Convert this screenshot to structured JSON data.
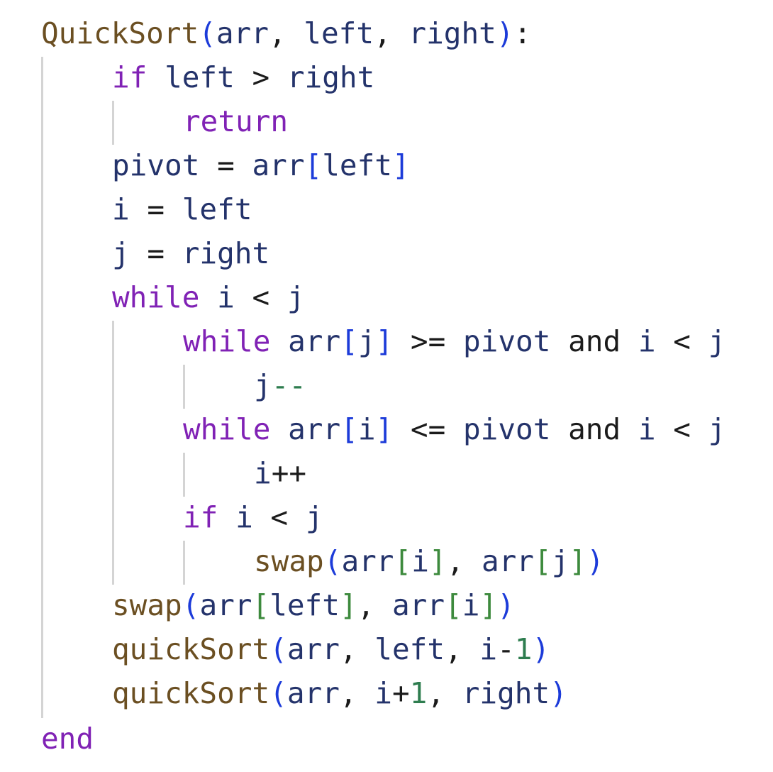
{
  "code_lines": [
    {
      "tokens": [
        [
          "fn",
          "QuickSort"
        ],
        [
          "bk1",
          "("
        ],
        [
          "var",
          "arr"
        ],
        [
          "op",
          ", "
        ],
        [
          "var",
          "left"
        ],
        [
          "op",
          ", "
        ],
        [
          "var",
          "right"
        ],
        [
          "bk1",
          ")"
        ],
        [
          "op",
          ":"
        ]
      ]
    },
    {
      "tokens": [
        [
          "kw",
          "if"
        ],
        [
          "op",
          " "
        ],
        [
          "var",
          "left"
        ],
        [
          "op",
          " > "
        ],
        [
          "var",
          "right"
        ]
      ]
    },
    {
      "tokens": [
        [
          "kw",
          "return"
        ]
      ]
    },
    {
      "tokens": [
        [
          "var",
          "pivot"
        ],
        [
          "op",
          " = "
        ],
        [
          "var",
          "arr"
        ],
        [
          "bk1",
          "["
        ],
        [
          "var",
          "left"
        ],
        [
          "bk1",
          "]"
        ]
      ]
    },
    {
      "tokens": [
        [
          "var",
          "i"
        ],
        [
          "op",
          " = "
        ],
        [
          "var",
          "left"
        ]
      ]
    },
    {
      "tokens": [
        [
          "var",
          "j"
        ],
        [
          "op",
          " = "
        ],
        [
          "var",
          "right"
        ]
      ]
    },
    {
      "tokens": [
        [
          "kw",
          "while"
        ],
        [
          "op",
          " "
        ],
        [
          "var",
          "i"
        ],
        [
          "op",
          " < "
        ],
        [
          "var",
          "j"
        ]
      ]
    },
    {
      "tokens": [
        [
          "kw",
          "while"
        ],
        [
          "op",
          " "
        ],
        [
          "var",
          "arr"
        ],
        [
          "bk1",
          "["
        ],
        [
          "var",
          "j"
        ],
        [
          "bk1",
          "]"
        ],
        [
          "op",
          " >= "
        ],
        [
          "var",
          "pivot"
        ],
        [
          "op",
          " and "
        ],
        [
          "var",
          "i"
        ],
        [
          "op",
          " < "
        ],
        [
          "var",
          "j"
        ]
      ]
    },
    {
      "tokens": [
        [
          "var",
          "j"
        ],
        [
          "num",
          "--"
        ]
      ]
    },
    {
      "tokens": [
        [
          "kw",
          "while"
        ],
        [
          "op",
          " "
        ],
        [
          "var",
          "arr"
        ],
        [
          "bk1",
          "["
        ],
        [
          "var",
          "i"
        ],
        [
          "bk1",
          "]"
        ],
        [
          "op",
          " <= "
        ],
        [
          "var",
          "pivot"
        ],
        [
          "op",
          " and "
        ],
        [
          "var",
          "i"
        ],
        [
          "op",
          " < "
        ],
        [
          "var",
          "j"
        ]
      ]
    },
    {
      "tokens": [
        [
          "var",
          "i"
        ],
        [
          "op",
          "++"
        ]
      ]
    },
    {
      "tokens": [
        [
          "kw",
          "if"
        ],
        [
          "op",
          " "
        ],
        [
          "var",
          "i"
        ],
        [
          "op",
          " < "
        ],
        [
          "var",
          "j"
        ]
      ]
    },
    {
      "tokens": [
        [
          "fn",
          "swap"
        ],
        [
          "bk1",
          "("
        ],
        [
          "var",
          "arr"
        ],
        [
          "bk2",
          "["
        ],
        [
          "var",
          "i"
        ],
        [
          "bk2",
          "]"
        ],
        [
          "op",
          ", "
        ],
        [
          "var",
          "arr"
        ],
        [
          "bk2",
          "["
        ],
        [
          "var",
          "j"
        ],
        [
          "bk2",
          "]"
        ],
        [
          "bk1",
          ")"
        ]
      ]
    },
    {
      "tokens": [
        [
          "fn",
          "swap"
        ],
        [
          "bk1",
          "("
        ],
        [
          "var",
          "arr"
        ],
        [
          "bk2",
          "["
        ],
        [
          "var",
          "left"
        ],
        [
          "bk2",
          "]"
        ],
        [
          "op",
          ", "
        ],
        [
          "var",
          "arr"
        ],
        [
          "bk2",
          "["
        ],
        [
          "var",
          "i"
        ],
        [
          "bk2",
          "]"
        ],
        [
          "bk1",
          ")"
        ]
      ]
    },
    {
      "tokens": [
        [
          "fn",
          "quickSort"
        ],
        [
          "bk1",
          "("
        ],
        [
          "var",
          "arr"
        ],
        [
          "op",
          ", "
        ],
        [
          "var",
          "left"
        ],
        [
          "op",
          ", "
        ],
        [
          "var",
          "i"
        ],
        [
          "op",
          "-"
        ],
        [
          "num",
          "1"
        ],
        [
          "bk1",
          ")"
        ]
      ]
    },
    {
      "tokens": [
        [
          "fn",
          "quickSort"
        ],
        [
          "bk1",
          "("
        ],
        [
          "var",
          "arr"
        ],
        [
          "op",
          ", "
        ],
        [
          "var",
          "i"
        ],
        [
          "op",
          "+"
        ],
        [
          "num",
          "1"
        ],
        [
          "op",
          ", "
        ],
        [
          "var",
          "right"
        ],
        [
          "bk1",
          ")"
        ]
      ]
    },
    {
      "tokens": [
        [
          "kw",
          "end"
        ]
      ]
    }
  ],
  "colors": {
    "function": "#6b4f22",
    "variable": "#24336b",
    "keyword": "#8022b5",
    "bracket_outer": "#1c3bd9",
    "bracket_inner": "#3d8a3d",
    "operator": "#1b1b1b",
    "number": "#2e7d4f",
    "indent_guide": "#d4d4d4",
    "background": "#ffffff"
  }
}
